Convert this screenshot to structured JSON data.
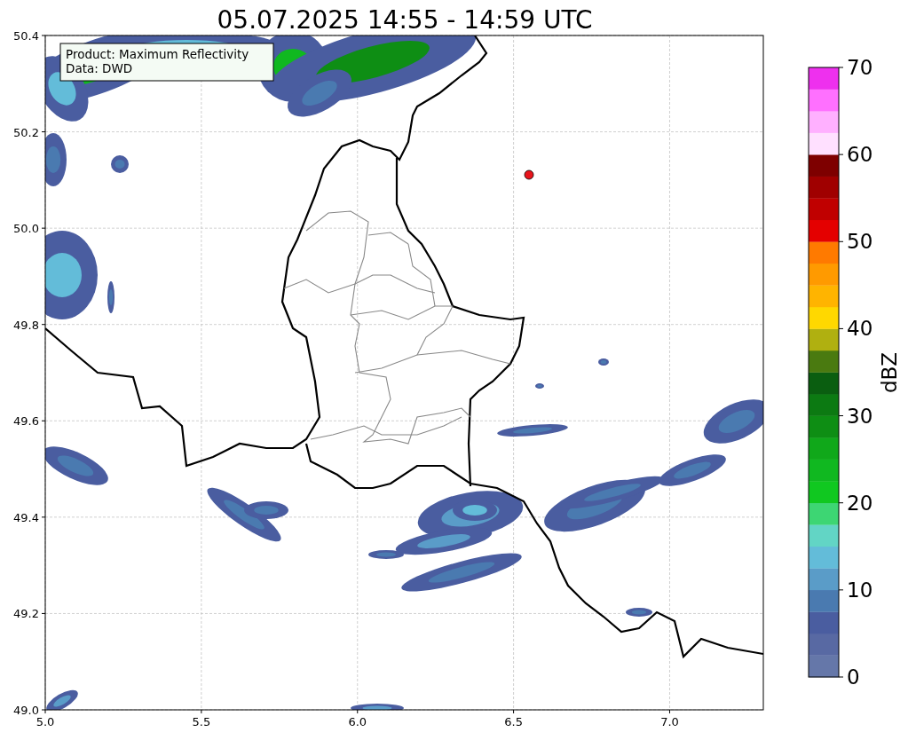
{
  "title": "05.07.2025 14:55 - 14:59 UTC",
  "info_box": {
    "lines": [
      "Product: Maximum Reflectivity",
      "Data: DWD"
    ]
  },
  "map": {
    "x_ticks": [
      "5.0",
      "5.5",
      "6.0",
      "6.5",
      "7.0"
    ],
    "y_ticks": [
      "50.4",
      "50.2",
      "50.0",
      "49.8",
      "49.6",
      "49.4",
      "49.2",
      "49.0"
    ]
  },
  "colorbar": {
    "label": "dBZ",
    "ticks": [
      "70",
      "60",
      "50",
      "40",
      "30",
      "20",
      "10",
      "0"
    ],
    "bands": [
      {
        "color": "#6577a9"
      },
      {
        "color": "#5869a3"
      },
      {
        "color": "#4a5da0"
      },
      {
        "color": "#4a7ab0"
      },
      {
        "color": "#5a9cc8"
      },
      {
        "color": "#63bcd9"
      },
      {
        "color": "#62d5c5"
      },
      {
        "color": "#3dd673"
      },
      {
        "color": "#10c820"
      },
      {
        "color": "#10b820"
      },
      {
        "color": "#10a81a"
      },
      {
        "color": "#0e8e14"
      },
      {
        "color": "#0c7a12"
      },
      {
        "color": "#0a5e10"
      },
      {
        "color": "#4a7a10"
      },
      {
        "color": "#b0b010"
      },
      {
        "color": "#ffd800"
      },
      {
        "color": "#ffb400"
      },
      {
        "color": "#ff9a00"
      },
      {
        "color": "#ff7a00"
      },
      {
        "color": "#e40000"
      },
      {
        "color": "#c00000"
      },
      {
        "color": "#a00000"
      },
      {
        "color": "#7e0000"
      },
      {
        "color": "#ffe0ff"
      },
      {
        "color": "#ffb0ff"
      },
      {
        "color": "#ff70ff"
      },
      {
        "color": "#ee30ee"
      }
    ]
  }
}
